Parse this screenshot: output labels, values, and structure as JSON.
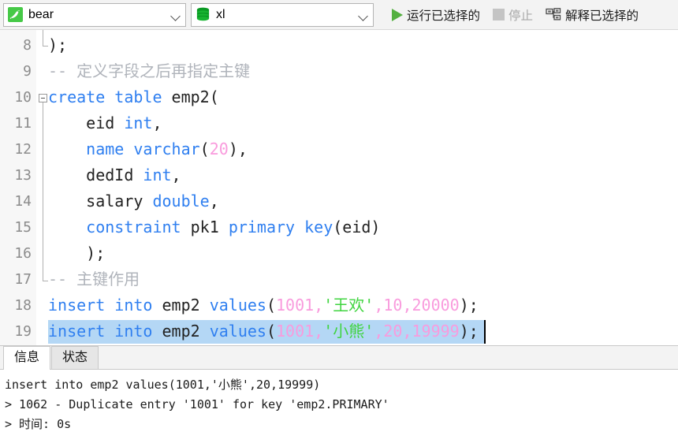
{
  "toolbar": {
    "connection": {
      "icon": "mysql-dolphin-icon",
      "label": "bear"
    },
    "database": {
      "icon": "database-icon",
      "label": "xl"
    },
    "run_selected": {
      "icon": "play-triangle-icon",
      "label": "运行已选择的"
    },
    "stop": {
      "icon": "stop-square-icon",
      "label": "停止",
      "enabled": false
    },
    "explain_selected": {
      "icon": "explain-tree-icon",
      "label": "解释已选择的"
    }
  },
  "editor": {
    "lines": [
      {
        "num": "8",
        "tokens": [
          {
            "t": ");",
            "c": "pln"
          }
        ]
      },
      {
        "num": "9",
        "tokens": [
          {
            "t": "-- 定义字段之后再指定主键",
            "c": "cmt"
          }
        ]
      },
      {
        "num": "10",
        "tokens": [
          {
            "t": "create table",
            "c": "kw"
          },
          {
            "t": " emp2(",
            "c": "pln"
          }
        ]
      },
      {
        "num": "11",
        "tokens": [
          {
            "t": "    eid ",
            "c": "pln"
          },
          {
            "t": "int",
            "c": "kw"
          },
          {
            "t": ",",
            "c": "pln"
          }
        ]
      },
      {
        "num": "12",
        "tokens": [
          {
            "t": "    ",
            "c": "pln"
          },
          {
            "t": "name varchar",
            "c": "kw"
          },
          {
            "t": "(",
            "c": "pln"
          },
          {
            "t": "20",
            "c": "num2"
          },
          {
            "t": "),",
            "c": "pln"
          }
        ]
      },
      {
        "num": "13",
        "tokens": [
          {
            "t": "    dedId ",
            "c": "pln"
          },
          {
            "t": "int",
            "c": "kw"
          },
          {
            "t": ",",
            "c": "pln"
          }
        ]
      },
      {
        "num": "14",
        "tokens": [
          {
            "t": "    salary ",
            "c": "pln"
          },
          {
            "t": "double",
            "c": "kw"
          },
          {
            "t": ",",
            "c": "pln"
          }
        ]
      },
      {
        "num": "15",
        "tokens": [
          {
            "t": "    ",
            "c": "pln"
          },
          {
            "t": "constraint",
            "c": "kw"
          },
          {
            "t": " pk1 ",
            "c": "pln"
          },
          {
            "t": "primary key",
            "c": "kw"
          },
          {
            "t": "(eid)",
            "c": "pln"
          }
        ]
      },
      {
        "num": "16",
        "tokens": [
          {
            "t": "    );",
            "c": "pln"
          }
        ]
      },
      {
        "num": "17",
        "tokens": [
          {
            "t": "-- 主键作用",
            "c": "cmt"
          }
        ]
      },
      {
        "num": "18",
        "tokens": [
          {
            "t": "insert into",
            "c": "kw"
          },
          {
            "t": " emp2 ",
            "c": "pln"
          },
          {
            "t": "values",
            "c": "kw"
          },
          {
            "t": "(",
            "c": "pln"
          },
          {
            "t": "1001",
            "c": "num2"
          },
          {
            "t": ",",
            "c": "num2"
          },
          {
            "t": "'王欢'",
            "c": "str"
          },
          {
            "t": ",",
            "c": "num2"
          },
          {
            "t": "10",
            "c": "num2"
          },
          {
            "t": ",",
            "c": "num2"
          },
          {
            "t": "20000",
            "c": "num2"
          },
          {
            "t": ");",
            "c": "pln"
          }
        ]
      },
      {
        "num": "19",
        "selected": true,
        "tokens": [
          {
            "t": "insert into",
            "c": "kw"
          },
          {
            "t": " emp2 ",
            "c": "pln"
          },
          {
            "t": "values",
            "c": "kw"
          },
          {
            "t": "(",
            "c": "pln"
          },
          {
            "t": "1001",
            "c": "num2"
          },
          {
            "t": ",",
            "c": "num2"
          },
          {
            "t": "'小熊'",
            "c": "str"
          },
          {
            "t": ",",
            "c": "num2"
          },
          {
            "t": "20",
            "c": "num2"
          },
          {
            "t": ",",
            "c": "num2"
          },
          {
            "t": "19999",
            "c": "num2"
          },
          {
            "t": ");",
            "c": "pln"
          }
        ]
      }
    ]
  },
  "panel": {
    "tabs": [
      {
        "label": "信息",
        "active": true
      },
      {
        "label": "状态",
        "active": false
      }
    ],
    "log": [
      "insert into emp2 values(1001,'小熊',20,19999)",
      "> 1062 - Duplicate entry '1001' for key 'emp2.PRIMARY'",
      "> 时间: 0s"
    ]
  },
  "colors": {
    "keyword": "#2f7ff0",
    "number": "#f99bdd",
    "string": "#3fd43f",
    "comment": "#b0b4bb",
    "selection": "#b4d7f5",
    "accent_green": "#46c947"
  }
}
